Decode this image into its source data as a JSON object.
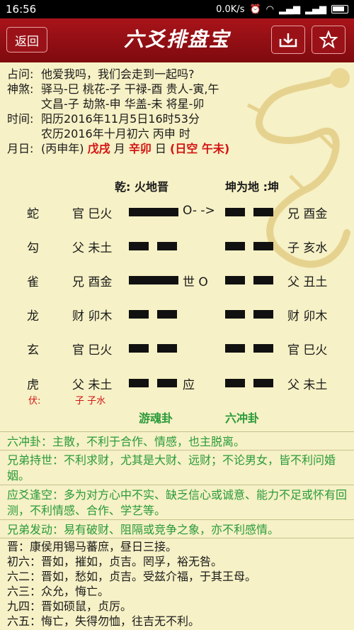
{
  "status": {
    "time": "16:56",
    "net": "0.0K/s"
  },
  "header": {
    "back_label": "返回",
    "title": "六爻排盘宝"
  },
  "info": {
    "question_label": "占问:",
    "question": "他爱我吗，我们会走到一起吗?",
    "shensha_label": "神煞:",
    "shensha_line1": "驿马-巳  桃花-子  干禄-酉  贵人-寅,午",
    "shensha_line2": "文昌-子  劫煞-申  华盖-未  将星-卯",
    "time_label": "时间:",
    "time_solar": "阳历2016年11月5日16时53分",
    "time_lunar": "农历2016年十月初六 丙申 时",
    "month_day_label": "月日:",
    "year_gz": "(丙申年)",
    "month_gz": "戊戌",
    "month_word": "月",
    "day_gz": "辛卯",
    "day_word": "日",
    "kong": "(日空 午未)"
  },
  "hexagram": {
    "main_title": "乾: 火地晋",
    "changed_title": "坤为地 :坤",
    "rows": [
      {
        "god": "蛇",
        "left": "官 巳火",
        "right": "兄 酉金",
        "mark": "O- ->"
      },
      {
        "god": "勾",
        "left": "父 未土",
        "right": "子 亥水",
        "mark": ""
      },
      {
        "god": "雀",
        "left": "兄 酉金",
        "right": "父 丑土",
        "mark": "世 O"
      },
      {
        "god": "龙",
        "left": "财 卯木",
        "right": "财 卯木",
        "mark": ""
      },
      {
        "god": "玄",
        "left": "官 巳火",
        "right": "官 巳火",
        "mark": ""
      },
      {
        "god": "虎",
        "left": "父 未土",
        "right": "父 未土",
        "mark": "应"
      }
    ],
    "fu_label": "伏:",
    "fu_value": "子 子水",
    "main_type": "游魂卦",
    "changed_type": "六冲卦"
  },
  "analysis": [
    "六冲卦：主散，不利于合作、情感，也主脱离。",
    "兄弟持世：不利求财，尤其是大财、远财；不论男女，皆不利问婚姻。",
    "应爻逢空：多为对方心中不实、缺乏信心或诚意、能力不足或怀有回测，不利情感、合作、学艺等。",
    "兄弟发动：易有破财、阻隔或竞争之象，亦不利感情。"
  ],
  "classic": [
    "晋：康侯用锡马蕃庶，昼日三接。",
    "初六：晋如，摧如，贞吉。罔孚，裕无咎。",
    "六二：晋如，愁如，贞吉。受兹介福，于其王母。",
    "六三：众允，悔亡。",
    "九四：晋如硕鼠，贞厉。",
    "六五：悔亡，失得勿恤，往吉无不利。"
  ]
}
